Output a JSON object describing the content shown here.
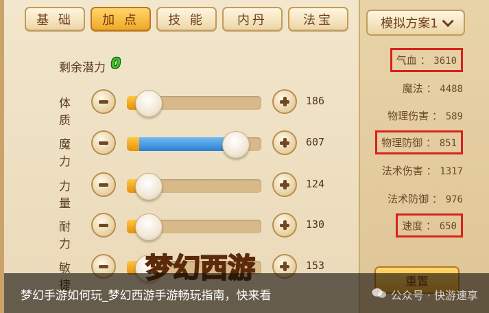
{
  "tabs": [
    {
      "label": "基 础",
      "active": false
    },
    {
      "label": "加 点",
      "active": true
    },
    {
      "label": "技 能",
      "active": false
    },
    {
      "label": "内丹",
      "active": false
    },
    {
      "label": "法宝",
      "active": false
    }
  ],
  "scheme_selector": {
    "label": "模拟方案1"
  },
  "remaining": {
    "label": "剩余潜力",
    "value": "0"
  },
  "attributes": [
    {
      "label": "体质",
      "value": "186",
      "base_fill": 0.09,
      "added_fill": 0.0
    },
    {
      "label": "魔力",
      "value": "607",
      "base_fill": 0.09,
      "added_fill": 0.65
    },
    {
      "label": "力量",
      "value": "124",
      "base_fill": 0.09,
      "added_fill": 0.0
    },
    {
      "label": "耐力",
      "value": "130",
      "base_fill": 0.09,
      "added_fill": 0.0
    },
    {
      "label": "敏捷",
      "value": "153",
      "base_fill": 0.09,
      "added_fill": 0.0
    }
  ],
  "stats": [
    {
      "label": "气血",
      "value": "3610",
      "highlighted": true
    },
    {
      "label": "魔法",
      "value": "4488",
      "highlighted": false
    },
    {
      "label": "物理伤害",
      "value": "589",
      "highlighted": false
    },
    {
      "label": "物理防御",
      "value": "851",
      "highlighted": true
    },
    {
      "label": "法术伤害",
      "value": "1317",
      "highlighted": false
    },
    {
      "label": "法术防御",
      "value": "976",
      "highlighted": false
    },
    {
      "label": "速度",
      "value": "650",
      "highlighted": true
    }
  ],
  "reset_button": {
    "label": "重置"
  },
  "logo": {
    "text": "梦幻西游"
  },
  "caption": {
    "text": "梦幻手游如何玩_梦幻西游手游畅玩指南，快来看"
  },
  "watermark": {
    "text": "公众号 · 快游速享"
  },
  "colors": {
    "highlight": "#d8211d",
    "remain_value": "#3fc52b",
    "active_tab": "#f0a826"
  }
}
